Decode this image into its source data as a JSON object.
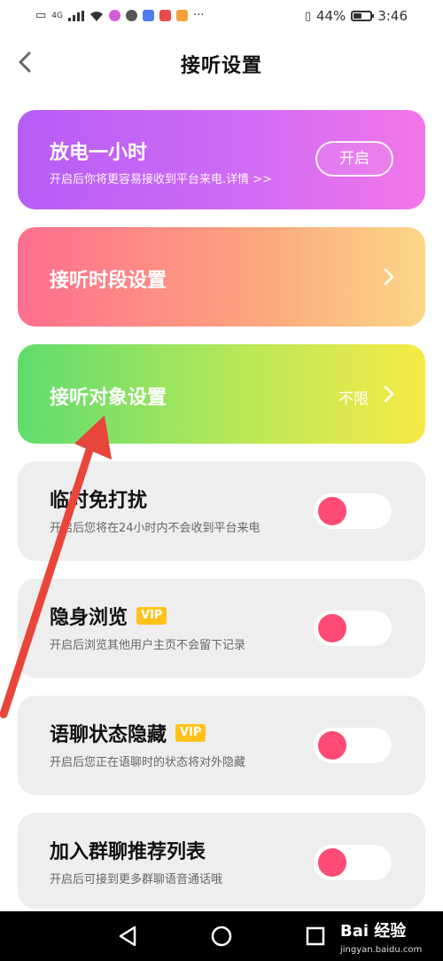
{
  "status_bar": {
    "network": "4G",
    "battery": "44%",
    "time": "3:46",
    "icons": [
      "signal-icon",
      "wifi-icon",
      "notification-icons"
    ]
  },
  "header": {
    "title": "接听设置",
    "back_icon": "chevron-left-icon"
  },
  "cards": {
    "power_hour": {
      "title": "放电一小时",
      "subtitle": "开启后你将更容易接收到平台来电.详情 >>",
      "button_label": "开启"
    },
    "answer_period": {
      "title": "接听时段设置"
    },
    "answer_target": {
      "title": "接听对象设置",
      "value": "不限"
    }
  },
  "toggles": [
    {
      "title": "临时免打扰",
      "subtitle": "开启后您将在24小时内不会收到平台来电",
      "vip": false,
      "checked": false
    },
    {
      "title": "隐身浏览",
      "subtitle": "开启后浏览其他用户主页不会留下记录",
      "vip": true,
      "vip_label": "VIP",
      "checked": false
    },
    {
      "title": "语聊状态隐藏",
      "subtitle": "开启后您正在语聊时的状态将对外隐藏",
      "vip": true,
      "vip_label": "VIP",
      "checked": false
    },
    {
      "title": "加入群聊推荐列表",
      "subtitle": "开启后可接到更多群聊语音通话哦",
      "vip": false,
      "checked": false
    }
  ],
  "nav": {
    "buttons": [
      "back-triangle-icon",
      "home-circle-icon",
      "recent-square-icon"
    ]
  },
  "watermark": {
    "text": "Bai 经验",
    "url_text": "jingyan.baidu.com"
  },
  "colors": {
    "power_gradient": [
      "#b65df7",
      "#f277e9"
    ],
    "period_gradient": [
      "#ff6e8f",
      "#fbd786"
    ],
    "target_gradient": [
      "#5fdc6d",
      "#f6ea46"
    ],
    "toggle_knob": "#ff4b75",
    "vip_badge": "#ffc21a",
    "annotation_arrow": "#e8463a"
  }
}
